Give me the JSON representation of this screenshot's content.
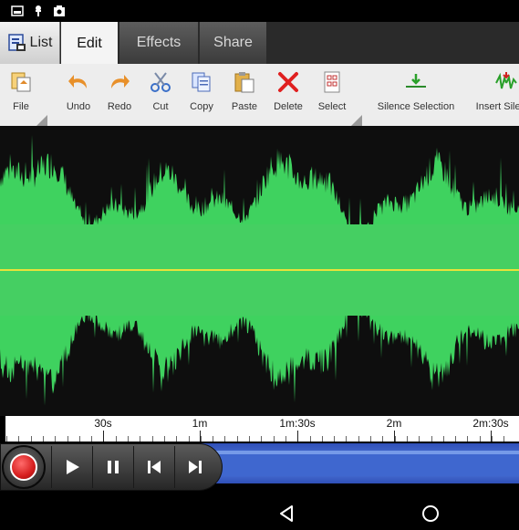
{
  "status_icons": [
    "image-icon",
    "pin-icon",
    "photo-icon"
  ],
  "tabs": [
    {
      "label": "List",
      "icon": "list-icon",
      "active": false
    },
    {
      "label": "Edit",
      "active": true
    },
    {
      "label": "Effects",
      "active": false
    },
    {
      "label": "Share",
      "active": false
    }
  ],
  "toolbar": {
    "file": "File",
    "undo": "Undo",
    "redo": "Redo",
    "cut": "Cut",
    "copy": "Copy",
    "paste": "Paste",
    "delete": "Delete",
    "select": "Select",
    "silence_selection": "Silence Selection",
    "insert_silence": "Insert Silence"
  },
  "waveform": {
    "color": "#3fd25f",
    "center_line_color": "#e8e23a",
    "background": "#0e0e0e"
  },
  "timeline": {
    "ticks": [
      "30s",
      "1m",
      "1m:30s",
      "2m",
      "2m:30s"
    ]
  },
  "transport": {
    "buttons": [
      "record-icon",
      "play-icon",
      "pause-icon",
      "skip-to-start-icon",
      "skip-to-end-icon"
    ],
    "accent": "#4a74dc"
  },
  "nav": [
    "back-icon",
    "home-icon"
  ]
}
